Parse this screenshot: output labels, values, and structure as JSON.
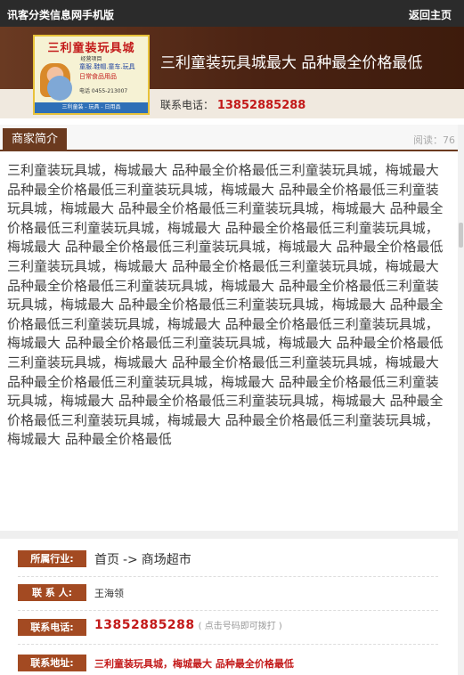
{
  "topbar": {
    "site_name": "讯客分类信息网手机版",
    "back_home": "返回主页"
  },
  "logo": {
    "title": "三利童装玩具城",
    "subtitle": "经营项目",
    "items_line1": "童服.鞋帽.童车.玩具",
    "items_line2": "日常食品用品",
    "phone": "电话 0455-213007",
    "strip": "三利童装 - 玩具 - 日用品"
  },
  "header": {
    "title": "三利童装玩具城最大 品种最全价格最低",
    "phone_label": "联系电话：",
    "phone": "13852885288"
  },
  "section": {
    "tab_label": "商家简介",
    "read_label": "阅读：",
    "read_count": "76"
  },
  "intro_text": "三利童装玩具城，梅城最大 品种最全价格最低三利童装玩具城，梅城最大 品种最全价格最低三利童装玩具城，梅城最大 品种最全价格最低三利童装玩具城，梅城最大 品种最全价格最低三利童装玩具城，梅城最大 品种最全价格最低三利童装玩具城，梅城最大 品种最全价格最低三利童装玩具城，梅城最大 品种最全价格最低三利童装玩具城，梅城最大 品种最全价格最低三利童装玩具城，梅城最大 品种最全价格最低三利童装玩具城，梅城最大 品种最全价格最低三利童装玩具城，梅城最大 品种最全价格最低三利童装玩具城，梅城最大 品种最全价格最低三利童装玩具城，梅城最大 品种最全价格最低三利童装玩具城，梅城最大 品种最全价格最低三利童装玩具城，梅城最大 品种最全价格最低三利童装玩具城，梅城最大 品种最全价格最低三利童装玩具城，梅城最大 品种最全价格最低三利童装玩具城，梅城最大 品种最全价格最低三利童装玩具城，梅城最大 品种最全价格最低三利童装玩具城，梅城最大 品种最全价格最低三利童装玩具城，梅城最大 品种最全价格最低三利童装玩具城，梅城最大 品种最全价格最低三利童装玩具城，梅城最大 品种最全价格最低",
  "info": {
    "industry_label": "所属行业:",
    "industry_home": "首页",
    "industry_arrow": "->",
    "industry_category": "商场超市",
    "contact_label": "联 系 人:",
    "contact_name": "王海领",
    "phone_label": "联系电话:",
    "phone": "13852885288",
    "phone_hint": "( 点击号码即可拨打 )",
    "address_label": "联系地址:",
    "address": "三利童装玩具城，梅城最大 品种最全价格最低"
  },
  "colors": {
    "accent_brown": "#6b3a1f",
    "label_bg": "#a34a22",
    "phone_red": "#c31a1a"
  }
}
